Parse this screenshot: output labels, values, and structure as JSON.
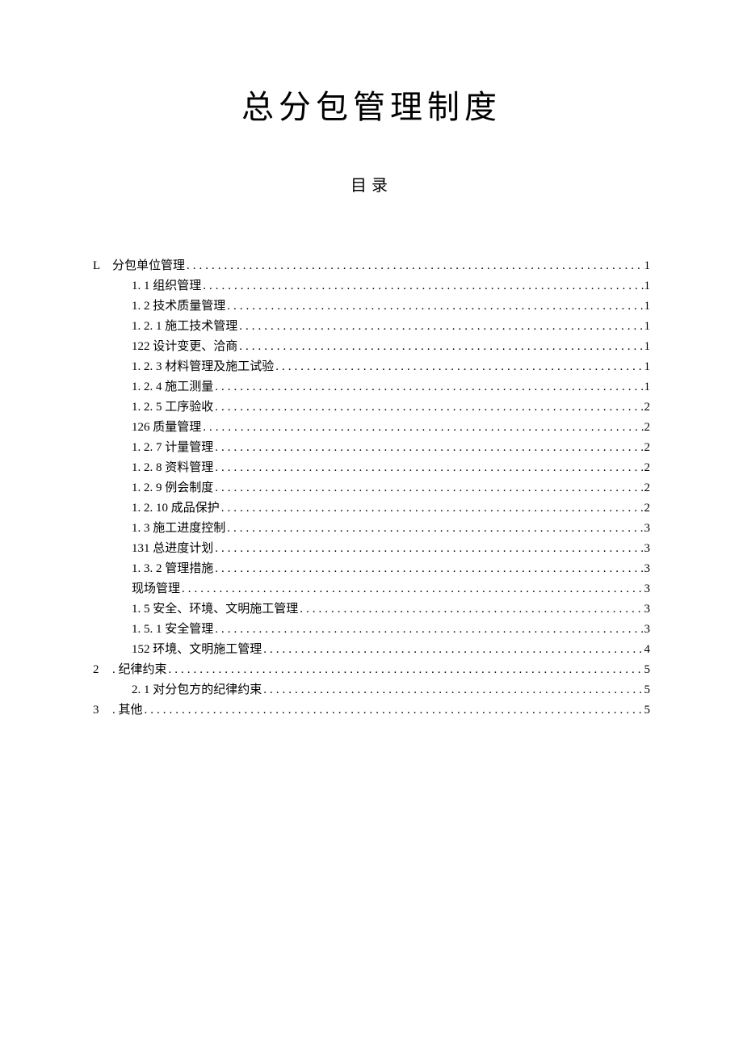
{
  "title": "总分包管理制度",
  "toc_title": "目录",
  "toc": [
    {
      "level": 0,
      "prefix": "L",
      "label": "分包单位管理",
      "page": "1"
    },
    {
      "level": 1,
      "prefix": "",
      "label": "1. 1 组织管理",
      "page": "1"
    },
    {
      "level": 1,
      "prefix": "",
      "label": "1. 2 技术质量管理",
      "page": "1"
    },
    {
      "level": 1,
      "prefix": "",
      "label": "1. 2. 1 施工技术管理",
      "page": "1"
    },
    {
      "level": 1,
      "prefix": "",
      "label": "122 设计变更、洽商",
      "page": "1"
    },
    {
      "level": 1,
      "prefix": "",
      "label": "1. 2. 3 材料管理及施工试验",
      "page": "1"
    },
    {
      "level": 1,
      "prefix": "",
      "label": "1. 2. 4 施工测量",
      "page": "1"
    },
    {
      "level": 1,
      "prefix": "",
      "label": "1. 2. 5 工序验收",
      "page": "2"
    },
    {
      "level": 1,
      "prefix": "",
      "label": "126 质量管理",
      "page": "2"
    },
    {
      "level": 1,
      "prefix": "",
      "label": "1. 2. 7 计量管理",
      "page": "2"
    },
    {
      "level": 1,
      "prefix": "",
      "label": "1. 2. 8 资料管理",
      "page": "2"
    },
    {
      "level": 1,
      "prefix": "",
      "label": "1. 2. 9 例会制度",
      "page": "2"
    },
    {
      "level": 1,
      "prefix": "",
      "label": "1. 2. 10 成品保护",
      "page": "2"
    },
    {
      "level": 1,
      "prefix": "",
      "label": "1. 3 施工进度控制",
      "page": "3"
    },
    {
      "level": 1,
      "prefix": "",
      "label": "131 总进度计划",
      "page": "3"
    },
    {
      "level": 1,
      "prefix": "",
      "label": "1. 3. 2 管理措施",
      "page": "3"
    },
    {
      "level": 1,
      "prefix": "",
      "label": "现场管理",
      "page": "3"
    },
    {
      "level": 1,
      "prefix": "",
      "label": "1. 5 安全、环境、文明施工管理",
      "page": "3"
    },
    {
      "level": 1,
      "prefix": "",
      "label": "1. 5. 1 安全管理",
      "page": "3"
    },
    {
      "level": 1,
      "prefix": "",
      "label": "152 环境、文明施工管理",
      "page": "4"
    },
    {
      "level": 0,
      "prefix": "2",
      "label": ". 纪律约束",
      "page": "5"
    },
    {
      "level": 1,
      "prefix": "",
      "label": "2. 1 对分包方的纪律约束",
      "page": "5"
    },
    {
      "level": 0,
      "prefix": "3",
      "label": ". 其他",
      "page": "5"
    }
  ]
}
